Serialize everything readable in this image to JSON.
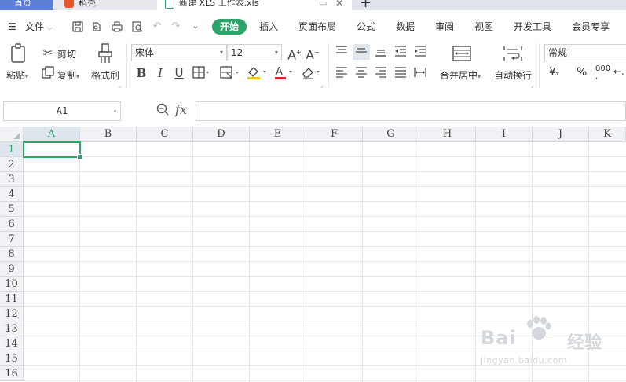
{
  "tabs": {
    "home": "首页",
    "daoke": "稻壳",
    "doc": "新建 XLS 工作表.xls",
    "add": "+"
  },
  "menubar": {
    "file": "文件",
    "start": "开始",
    "items": [
      "插入",
      "页面布局",
      "公式",
      "数据",
      "审阅",
      "视图",
      "开发工具",
      "会员专享"
    ]
  },
  "ribbon": {
    "paste": "粘贴",
    "cut": "剪切",
    "copy": "复制",
    "format_painter": "格式刷",
    "font_name": "宋体",
    "font_size": "12",
    "merge_center": "合并居中",
    "wrap_text": "自动换行",
    "number_format": "常规",
    "currency_symbol": "¥",
    "percent_symbol": "%",
    "thousands_symbol": "000"
  },
  "formula_bar": {
    "name_box": "A1",
    "fx": "fx",
    "value": ""
  },
  "grid": {
    "columns": [
      "A",
      "B",
      "C",
      "D",
      "E",
      "F",
      "G",
      "H",
      "I",
      "J",
      "K"
    ],
    "rows": [
      "1",
      "2",
      "3",
      "4",
      "5",
      "6",
      "7",
      "8",
      "9",
      "10",
      "11",
      "12",
      "13",
      "14",
      "15",
      "16"
    ],
    "active_cell": "A1"
  },
  "watermark": {
    "brand_left": "Bai",
    "brand_right": "经验",
    "url": "jingyan.baidu.com"
  },
  "colors": {
    "accent": "#2da46a",
    "tab_home": "#5b7fd6"
  }
}
